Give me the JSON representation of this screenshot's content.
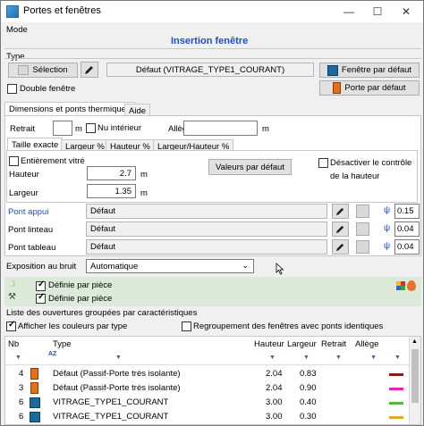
{
  "window": {
    "title": "Portes et fenêtres",
    "minimize": "—",
    "maximize": "☐",
    "close": "✕"
  },
  "mode": {
    "label": "Mode",
    "value": "Insertion fenêtre"
  },
  "type": {
    "label": "Type",
    "selection_btn": "Sélection",
    "default_value": "Défaut (VITRAGE_TYPE1_COURANT)",
    "fenetre_default_btn": "Fenêtre par défaut",
    "porte_default_btn": "Porte par défaut",
    "double_fenetre": "Double fenêtre"
  },
  "tabs": {
    "dims": "Dimensions et ponts thermiques",
    "aide": "Aide"
  },
  "dims": {
    "retrait": "Retrait",
    "retrait_unit": "m",
    "nu_interieur": "Nu intérieur",
    "allege": "Allège",
    "allege_unit": "m",
    "subtabs": [
      "Taille exacte",
      "Largeur %",
      "Hauteur %",
      "Largeur/Hauteur %"
    ],
    "entierement_vitre": "Entièrement vitré",
    "hauteur_label": "Hauteur",
    "hauteur_value": "2.7",
    "hauteur_unit": "m",
    "largeur_label": "Largeur",
    "largeur_value": "1.35",
    "largeur_unit": "m",
    "valeurs_defaut_btn": "Valeurs par défaut",
    "desactiver_1": "Désactiver le contrôle",
    "desactiver_2": "de la hauteur"
  },
  "ponts": [
    {
      "label": "Pont appui",
      "value": "Défaut",
      "psi": "ψ",
      "psi_value": "0.15"
    },
    {
      "label": "Pont linteau",
      "value": "Défaut",
      "psi": "ψ",
      "psi_value": "0.04"
    },
    {
      "label": "Pont tableau",
      "value": "Défaut",
      "psi": "ψ",
      "psi_value": "0.04"
    }
  ],
  "bruit": {
    "label": "Exposition au bruit",
    "value": "Automatique"
  },
  "piece": {
    "line1": "Définie par pièce",
    "line2": "Définie par pièce"
  },
  "list": {
    "label": "Liste des ouvertures groupées par caractéristiques",
    "afficher": "Afficher les couleurs par type",
    "regrouper": "Regroupement des fenêtres avec ponts identiques",
    "headers": {
      "nb": "Nb",
      "type": "Type",
      "hauteur": "Hauteur",
      "largeur": "Largeur",
      "retrait": "Retrait",
      "allege": "Allège"
    },
    "sort_label": "AZ",
    "rows": [
      {
        "nb": "4",
        "icon": "door",
        "type": "Défaut (Passif-Porte très isolante)",
        "hauteur": "2.04",
        "largeur": "0.83",
        "color": "#8b1a1a"
      },
      {
        "nb": "3",
        "icon": "door",
        "type": "Défaut (Passif-Porte très isolante)",
        "hauteur": "2.04",
        "largeur": "0.90",
        "color": "#e81ec8"
      },
      {
        "nb": "6",
        "icon": "window",
        "type": "VITRAGE_TYPE1_COURANT",
        "hauteur": "3.00",
        "largeur": "0.40",
        "color": "#55b82e"
      },
      {
        "nb": "6",
        "icon": "window",
        "type": "VITRAGE_TYPE1_COURANT",
        "hauteur": "3.00",
        "largeur": "0.30",
        "color": "#e3a92b"
      }
    ]
  },
  "colors": {
    "accent": "#1a4fd6",
    "bruit_bg": "#dcebd9"
  }
}
